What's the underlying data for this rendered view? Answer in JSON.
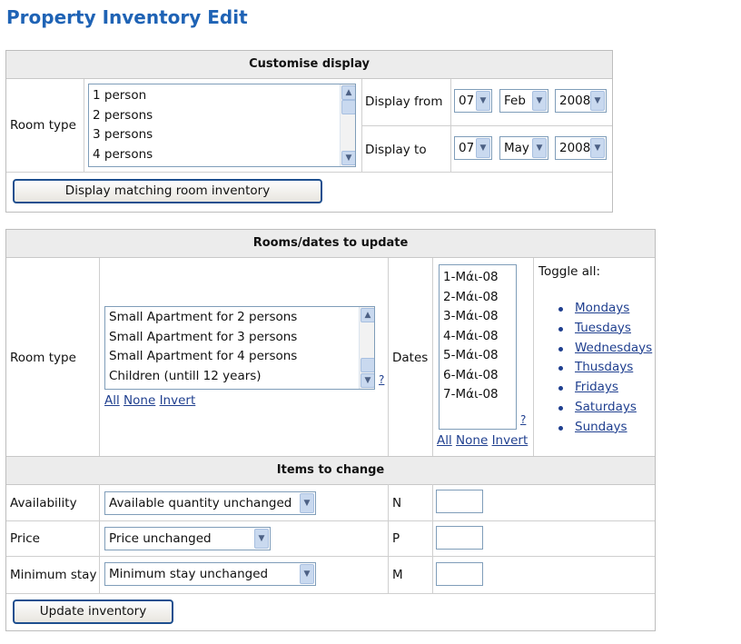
{
  "page_title": "Property Inventory Edit",
  "customise": {
    "header": "Customise display",
    "room_type_label": "Room type",
    "room_types": [
      "1 person",
      "2 persons",
      "3 persons",
      "4 persons"
    ],
    "display_from_label": "Display from",
    "display_to_label": "Display to",
    "from": {
      "day": "07",
      "month": "Feb",
      "year": "2008"
    },
    "to": {
      "day": "07",
      "month": "May",
      "year": "2008"
    },
    "button": "Display matching room inventory"
  },
  "rooms": {
    "header": "Rooms/dates to update",
    "room_type_label": "Room type",
    "room_types": [
      "Small Apartment for 2 persons",
      "Small Apartment for 3 persons",
      "Small Apartment for 4 persons",
      "Children (untill 12 years)"
    ],
    "help": "?",
    "all": "All",
    "none": "None",
    "invert": "Invert",
    "dates_label": "Dates",
    "dates": [
      "1-Μάι-08",
      "2-Μάι-08",
      "3-Μάι-08",
      "4-Μάι-08",
      "5-Μάι-08",
      "6-Μάι-08",
      "7-Μάι-08"
    ],
    "dates_help": "?",
    "dates_all": "All",
    "dates_none": "None",
    "dates_invert": "Invert",
    "toggle_all_label": "Toggle all:",
    "days": [
      "Mondays",
      "Tuesdays",
      "Wednesdays",
      "Thusdays",
      "Fridays",
      "Saturdays",
      "Sundays"
    ]
  },
  "items": {
    "header": "Items to change",
    "availability_label": "Availability",
    "availability_value": "Available quantity unchanged",
    "availability_code": "N",
    "price_label": "Price",
    "price_value": "Price unchanged",
    "price_code": "P",
    "minstay_label": "Minimum stay",
    "minstay_value": "Minimum stay unchanged",
    "minstay_code": "M",
    "button": "Update inventory"
  },
  "icons": {
    "scroll_up": "▲",
    "scroll_down": "▼",
    "dropdown": "▼"
  }
}
